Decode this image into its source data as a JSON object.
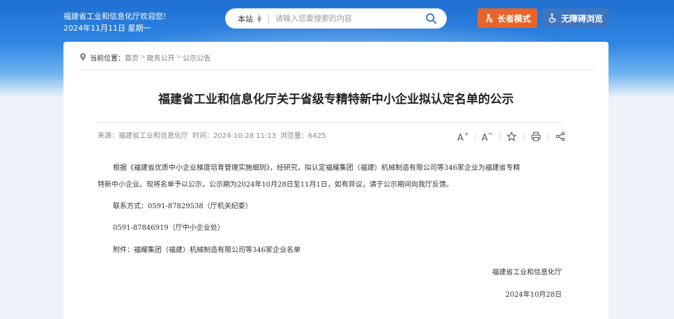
{
  "header": {
    "welcome": "福建省工业和信息化厅欢迎您!",
    "date": "2024年11月11日 星期一",
    "search": {
      "scope": "本站",
      "placeholder": "请输入您要搜索的内容"
    },
    "elder_mode_label": "长者模式",
    "accessible_label": "无障碍浏览",
    "colors": {
      "elder": "#e8642a",
      "accessible": "#3f74bf"
    }
  },
  "breadcrumb": {
    "label": "当前位置：",
    "items": [
      "首页",
      "政务公开",
      "公示公告"
    ]
  },
  "article": {
    "title": "福建省工业和信息化厅关于省级专精特新中小企业拟认定名单的公示",
    "source": "来源：福建省工业和信息化厅",
    "time": "时间：2024-10-28 11:13",
    "views": "浏览量：6425",
    "tools": [
      "font-increase-icon",
      "font-decrease-icon",
      "star-icon",
      "print-icon",
      "share-icon"
    ],
    "para1_line1": "根据《福建省优质中小企业梯度培育管理实施细则》，经研究，拟认定福耀集团（福建）机械制造有限公司等346家企业为福建省专精",
    "para1_line2": "特新中小企业。现将名单予以公示，公示期为2024年10月28日至11月1日，如有异议，请于公示期间向我厅反馈。",
    "contact1": "联系方式：0591-87829538（厅机关纪委）",
    "contact2": "0591-87846919（厅中小企业处）",
    "attachment": "附件：福耀集团（福建）机械制造有限公司等346家企业名单",
    "signature": "福建省工业和信息化厅",
    "sign_date": "2024年10月28日"
  }
}
